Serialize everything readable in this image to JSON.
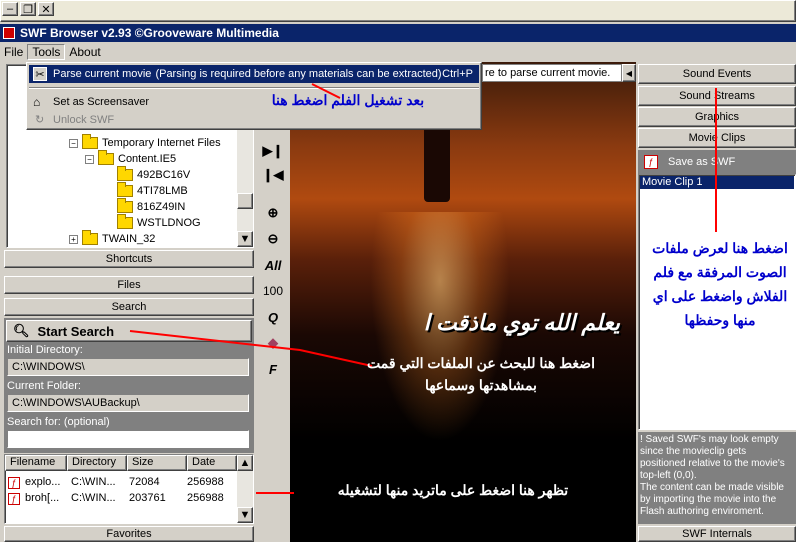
{
  "window": {
    "title": "SWF Browser v2.93  ©Grooveware Multimedia"
  },
  "menubar": [
    "File",
    "Tools",
    "About"
  ],
  "tools_menu": {
    "parse_label": "Parse current movie",
    "parse_hint": "(Parsing is required before any materials can be extracted)",
    "parse_shortcut": "Ctrl+P",
    "screensaver_label": "Set as Screensaver",
    "unlock_label": "Unlock SWF"
  },
  "status_hint": "re to parse current movie.",
  "tree": [
    {
      "label": "Temporary Internet Files",
      "expanded": true
    },
    {
      "label": "Content.IE5",
      "expanded": true
    },
    {
      "label": "492BC16V"
    },
    {
      "label": "4TI78LMB"
    },
    {
      "label": "816Z49IN"
    },
    {
      "label": "WSTLDNOG"
    },
    {
      "label": "TWAIN_32"
    }
  ],
  "left_panels": {
    "shortcuts": "Shortcuts",
    "files": "Files",
    "search": "Search",
    "favorites": "Favorites"
  },
  "search": {
    "start_label": "Start Search",
    "initial_dir_label": "Initial Directory:",
    "initial_dir_value": "C:\\WINDOWS\\",
    "current_folder_label": "Current Folder:",
    "current_folder_value": "C:\\WINDOWS\\AUBackup\\",
    "search_for_label": "Search for: (optional)",
    "search_for_value": ""
  },
  "results": {
    "columns": [
      "Filename",
      "Directory",
      "Size",
      "Date"
    ],
    "rows": [
      {
        "filename": "explo...",
        "directory": "C:\\WIN...",
        "size": "72084",
        "date": "256988"
      },
      {
        "filename": "broh[...",
        "directory": "C:\\WIN...",
        "size": "203761",
        "date": "256988"
      }
    ]
  },
  "toolbar_icons": [
    "play-forward-icon",
    "play-back-icon",
    "zoom-in-icon",
    "zoom-out-icon",
    "all-icon",
    "hundred-icon",
    "quality-icon",
    "stamp-icon",
    "font-icon"
  ],
  "toolbar_text": {
    "all": "All",
    "hundred": "100",
    "quality": "Q",
    "font": "F"
  },
  "right_panels": {
    "sound_events": "Sound Events",
    "sound_streams": "Sound Streams",
    "graphics": "Graphics",
    "movie_clips": "Movie Clips",
    "save_as_swf": "Save as SWF",
    "selected_clip": "Movie Clip 1",
    "note": "! Saved SWF's may look empty since the movieclip gets positioned relative to the movie's top-left (0,0).\nThe content can be made visible by importing the movie into the Flash authoring enviroment.",
    "swf_internals": "SWF Internals"
  },
  "movie_caption": "يعلم الله توي ماذقت ا",
  "annotations": {
    "parse": "بعد تشغيل الفلم اضغط هنا",
    "search": "اضغط هنا للبحث عن الملفات التي قمت بمشاهدتها وسماعها",
    "results": "تظهر هنا اضغط على ماتريد منها لتشغيله",
    "sounds": "اضغط هنا لعرض ملفات الصوت المرفقة مع فلم الفلاش واضغط على اي منها وحفظها"
  },
  "colors": {
    "titlebar": "#0a246a",
    "selection": "#0a246a",
    "annotation_line": "#ff0000",
    "annotation_blue": "#0000cc"
  }
}
